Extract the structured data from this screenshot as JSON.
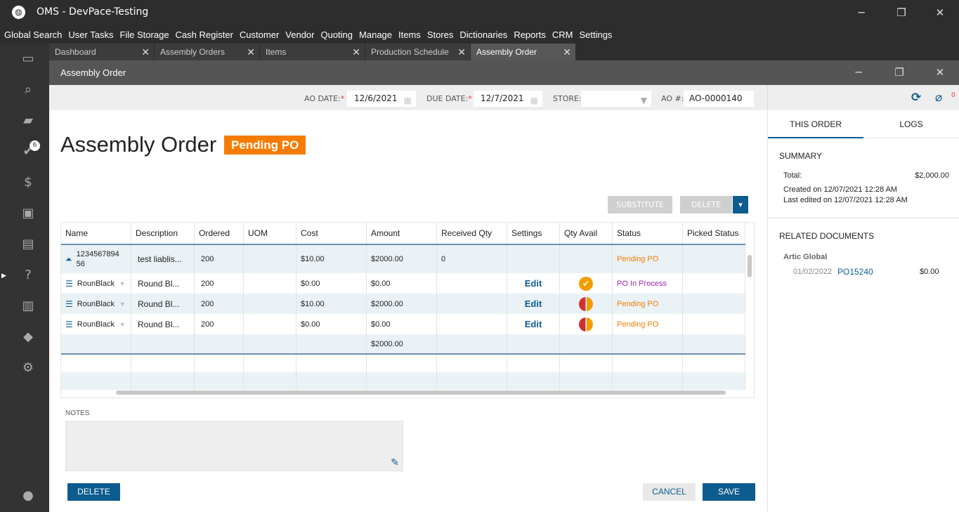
{
  "window": {
    "title": "OMS - DevPace-Testing"
  },
  "menu": [
    "Global Search",
    "User Tasks",
    "File Storage",
    "Cash Register",
    "Customer",
    "Vendor",
    "Quoting",
    "Manage",
    "Items",
    "Stores",
    "Dictionaries",
    "Reports",
    "CRM",
    "Settings"
  ],
  "sidebar": {
    "tasks_badge": "6"
  },
  "tabs": [
    {
      "label": "Dashboard"
    },
    {
      "label": "Assembly Orders"
    },
    {
      "label": "Items"
    },
    {
      "label": "Production Schedule"
    },
    {
      "label": "Assembly Order",
      "active": true
    }
  ],
  "dialog": {
    "title": "Assembly Order"
  },
  "toolbar": {
    "ao_date_label": "AO DATE:",
    "ao_date": "12/6/2021",
    "due_date_label": "DUE DATE:",
    "due_date": "12/7/2021",
    "store_label": "STORE:",
    "store": "",
    "ao_no_label": "AO #:",
    "ao_no": "AO-0000140",
    "required": "*"
  },
  "page": {
    "title": "Assembly Order",
    "status": "Pending PO"
  },
  "actions": {
    "substitute": "SUBSTITUTE",
    "delete": "DELETE",
    "dropdown": "▾"
  },
  "grid": {
    "columns": [
      "Name",
      "Description",
      "Ordered",
      "UOM",
      "Cost",
      "Amount",
      "Received Qty",
      "Settings",
      "Qty Avail",
      "Status",
      "Picked Status"
    ],
    "rows": [
      {
        "name": "1234567894 56",
        "description": "test liablis...",
        "ordered": "200",
        "uom": "",
        "cost": "$10.00",
        "amount": "$2000.00",
        "received": "0",
        "settings": "",
        "avail": "",
        "status": "Pending PO",
        "picked": ""
      },
      {
        "name": "RounBlack",
        "description": "Round Bl...",
        "ordered": "200",
        "uom": "",
        "cost": "$0.00",
        "amount": "$0.00",
        "received": "",
        "settings": "Edit",
        "avail": "ok",
        "status": "PO In Process",
        "picked": ""
      },
      {
        "name": "RounBlack",
        "description": "Round Bl...",
        "ordered": "200",
        "uom": "",
        "cost": "$10.00",
        "amount": "$2000.00",
        "received": "",
        "settings": "Edit",
        "avail": "partial",
        "status": "Pending PO",
        "picked": ""
      },
      {
        "name": "RounBlack",
        "description": "Round Bl...",
        "ordered": "200",
        "uom": "",
        "cost": "$0.00",
        "amount": "$0.00",
        "received": "",
        "settings": "Edit",
        "avail": "partial",
        "status": "Pending PO",
        "picked": ""
      }
    ],
    "total_amount": "$2000.00"
  },
  "notes": {
    "label": "NOTES",
    "value": ""
  },
  "footer": {
    "delete": "DELETE",
    "cancel": "CANCEL",
    "save": "SAVE"
  },
  "right": {
    "attachments": "0",
    "tabs": [
      "THIS ORDER",
      "LOGS"
    ],
    "summary": {
      "heading": "SUMMARY",
      "total_label": "Total:",
      "total": "$2,000.00",
      "created": "Created on 12/07/2021 12:28 AM",
      "edited": "Last edited on 12/07/2021 12:28 AM"
    },
    "related": {
      "heading": "RELATED DOCUMENTS",
      "vendor": "Artic Global",
      "date": "01/02/2022",
      "doc": "PO15240",
      "amount": "$0.00"
    }
  },
  "colors": {
    "accent": "#0d5c8f",
    "badge": "#f57c00",
    "purple": "#9c27b0"
  }
}
